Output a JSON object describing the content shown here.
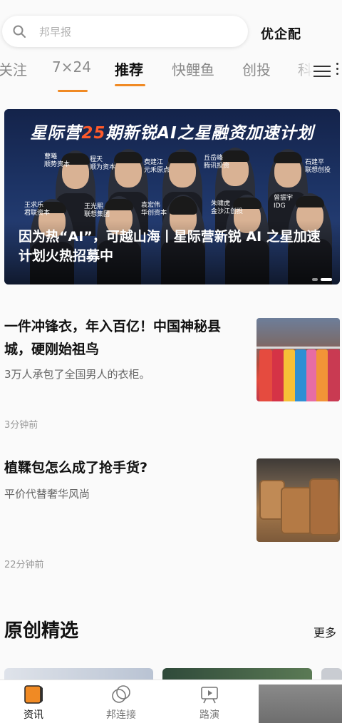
{
  "search": {
    "placeholder": "邦早报",
    "brand": "优企配"
  },
  "tabs": [
    {
      "label": "关注"
    },
    {
      "label": "7×24"
    },
    {
      "label": "推荐"
    },
    {
      "label": "快鲤鱼"
    },
    {
      "label": "创投"
    },
    {
      "label": "科"
    }
  ],
  "banner": {
    "title_pre": "星际营",
    "title_num": "25",
    "title_post": "期新锐AI之星融资加速计划",
    "caption": "因为热“AI”，可越山海丨星际营新锐 AI 之星加速计划火热招募中",
    "people": [
      {
        "name": "曹曦",
        "org": "顺势资本"
      },
      {
        "name": "程天",
        "org": "顺为资本"
      },
      {
        "name": "费建江",
        "org": "元禾原点"
      },
      {
        "name": "丘岳峰",
        "org": "腾讯投资"
      },
      {
        "name": "石建平",
        "org": "联想创投"
      },
      {
        "name": "王求乐",
        "org": "君联资本"
      },
      {
        "name": "王光熙",
        "org": "联想集团"
      },
      {
        "name": "袁宏伟",
        "org": "华创资本"
      },
      {
        "name": "朱啸虎",
        "org": "金沙江创投"
      },
      {
        "name": "曾振宇",
        "org": "IDG"
      }
    ]
  },
  "articles": [
    {
      "title": "一件冲锋衣，年入百亿！中国神秘县城，硬刚始祖鸟",
      "summary": "3万人承包了全国男人的衣柜。",
      "time": "3分钟前",
      "thumb": "clothing-rack-image"
    },
    {
      "title": "植鞣包怎么成了抢手货?",
      "summary": "平价代替奢华风尚",
      "time": "22分钟前",
      "thumb": "leather-bags-image"
    }
  ],
  "section": {
    "title": "原创精选",
    "more": "更多"
  },
  "bottom_nav": [
    {
      "label": "资讯",
      "icon": "news-icon",
      "active": true
    },
    {
      "label": "邦连接",
      "icon": "connect-icon",
      "active": false
    },
    {
      "label": "路演",
      "icon": "roadshow-icon",
      "active": false
    }
  ],
  "colors": {
    "accent": "#f08a24",
    "banner_highlight": "#ff5a2a",
    "banner_bg": "#1d3466"
  }
}
